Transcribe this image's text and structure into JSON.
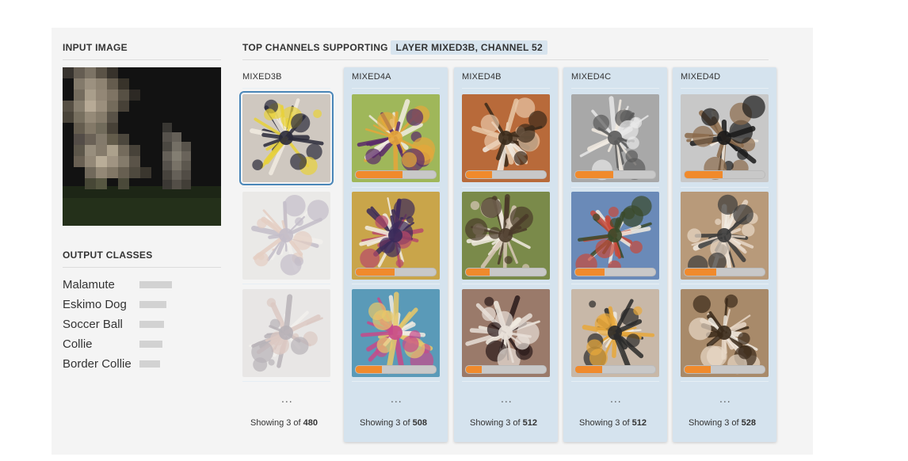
{
  "input_section": {
    "title": "INPUT IMAGE"
  },
  "output_section": {
    "title": "OUTPUT CLASSES",
    "classes": [
      {
        "label": "Malamute",
        "score": 1.0
      },
      {
        "label": "Eskimo Dog",
        "score": 0.83
      },
      {
        "label": "Soccer Ball",
        "score": 0.76
      },
      {
        "label": "Collie",
        "score": 0.7
      },
      {
        "label": "Border Collie",
        "score": 0.63
      }
    ]
  },
  "channels_section": {
    "title_prefix": "TOP CHANNELS SUPPORTING",
    "highlight": "LAYER MIXED3B, CHANNEL 52"
  },
  "columns": [
    {
      "name": "MIXED3B",
      "style": "plain",
      "showing_prefix": "Showing 3 of",
      "total": "480",
      "dots": "...",
      "thumbs": [
        {
          "icon": "feature-viz-stripes",
          "colors": [
            "#cfc8c0",
            "#2a2a3a",
            "#e8d23a"
          ],
          "strength": null
        },
        {
          "icon": "feature-viz-fan",
          "colors": [
            "#d9d5d0",
            "#6b5a7a",
            "#c98a6a"
          ],
          "strength": null
        },
        {
          "icon": "feature-viz-blob",
          "colors": [
            "#d3cfcb",
            "#4a3a4a",
            "#b07a6a"
          ],
          "strength": null
        }
      ]
    },
    {
      "name": "MIXED4A",
      "style": "highlight",
      "showing_prefix": "Showing 3 of",
      "total": "508",
      "dots": "...",
      "thumbs": [
        {
          "icon": "feature-viz-flower",
          "colors": [
            "#9fb75a",
            "#e6a63a",
            "#5a2a6a"
          ],
          "strength": 0.58
        },
        {
          "icon": "feature-viz-eyes",
          "colors": [
            "#c9a54a",
            "#3a2a5a",
            "#b84a6a"
          ],
          "strength": 0.49
        },
        {
          "icon": "feature-viz-burst",
          "colors": [
            "#5a9ab8",
            "#c84a8a",
            "#e8c86a"
          ],
          "strength": 0.33
        }
      ]
    },
    {
      "name": "MIXED4B",
      "style": "highlight",
      "showing_prefix": "Showing 3 of",
      "total": "512",
      "dots": "...",
      "thumbs": [
        {
          "icon": "feature-viz-bear",
          "colors": [
            "#b86a3a",
            "#3a2a1a",
            "#e8c8a8"
          ],
          "strength": 0.33
        },
        {
          "icon": "feature-viz-monkey",
          "colors": [
            "#7a8a4a",
            "#4a3a2a",
            "#d8c8b8"
          ],
          "strength": 0.3
        },
        {
          "icon": "feature-viz-snout",
          "colors": [
            "#9a7a6a",
            "#e8e0d8",
            "#2a1a1a"
          ],
          "strength": 0.2
        }
      ]
    },
    {
      "name": "MIXED4C",
      "style": "highlight",
      "showing_prefix": "Showing 3 of",
      "total": "512",
      "dots": "...",
      "thumbs": [
        {
          "icon": "feature-viz-fur",
          "colors": [
            "#a8a8a8",
            "#5a5a5a",
            "#e8e8e8"
          ],
          "strength": 0.48
        },
        {
          "icon": "feature-viz-bus",
          "colors": [
            "#6a8ab8",
            "#3a4a2a",
            "#c84a3a"
          ],
          "strength": 0.37
        },
        {
          "icon": "feature-viz-creature",
          "colors": [
            "#c8b8a8",
            "#2a2a2a",
            "#e8a83a"
          ],
          "strength": 0.34
        }
      ]
    },
    {
      "name": "MIXED4D",
      "style": "highlight",
      "showing_prefix": "Showing 3 of",
      "total": "528",
      "dots": "...",
      "thumbs": [
        {
          "icon": "feature-viz-puppy",
          "colors": [
            "#c8c8c8",
            "#1a1a1a",
            "#8a6a4a"
          ],
          "strength": 0.48
        },
        {
          "icon": "feature-viz-cat",
          "colors": [
            "#b89a7a",
            "#3a3a3a",
            "#e8d8c8"
          ],
          "strength": 0.4
        },
        {
          "icon": "feature-viz-hamster",
          "colors": [
            "#a88a6a",
            "#3a2a1a",
            "#e8d8c8"
          ],
          "strength": 0.33
        }
      ]
    }
  ]
}
